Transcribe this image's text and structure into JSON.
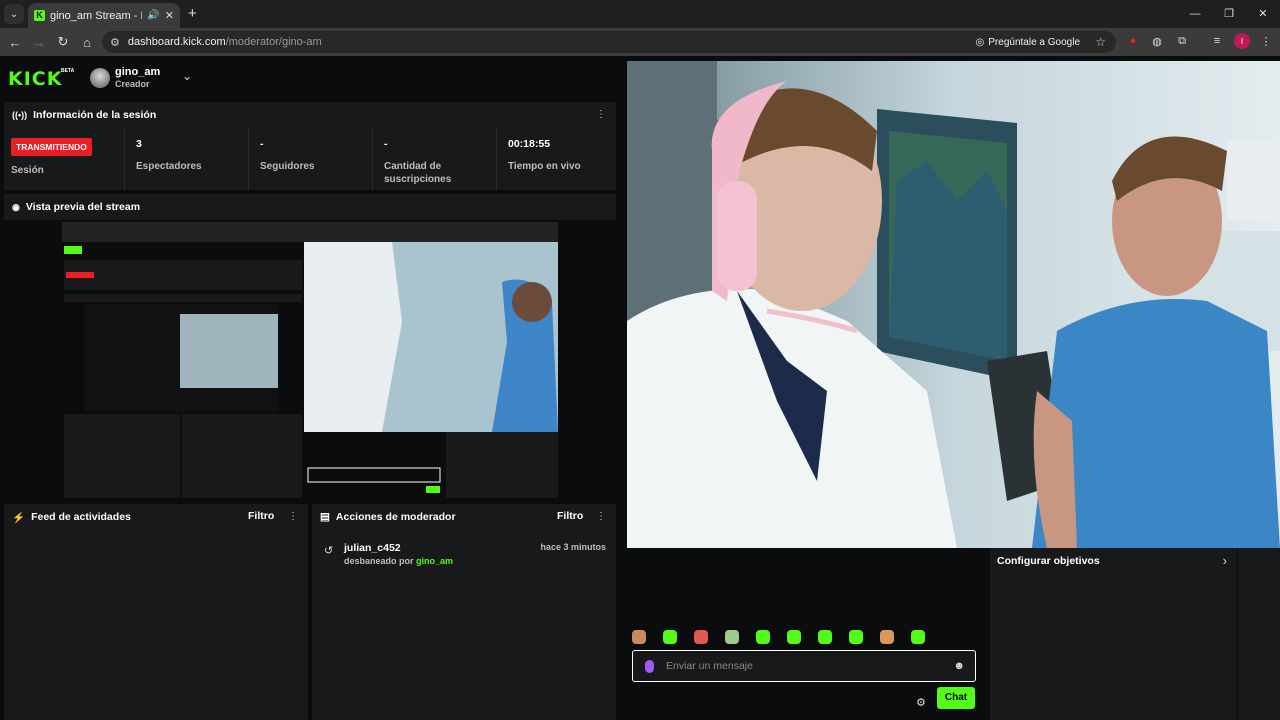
{
  "browser": {
    "tab_title": "gino_am Stream - Kick Das",
    "url_host": "dashboard.kick.com",
    "url_path": "/moderator/gino-am",
    "ask_google": "Pregúntale a Google",
    "profile_initial": "I"
  },
  "header": {
    "logo": "KICK",
    "logo_badge": "BETA",
    "channel_name": "gino_am",
    "channel_role": "Creador"
  },
  "session": {
    "title": "Información de la sesión",
    "badge": "TRANSMITIENDO",
    "session_label": "Sesión",
    "stats": [
      {
        "value": "3",
        "label": "Espectadores"
      },
      {
        "value": "-",
        "label": "Seguidores"
      },
      {
        "value": "-",
        "label": "Cantidad de suscripciones"
      },
      {
        "value": "00:18:55",
        "label": "Tiempo en vivo"
      }
    ]
  },
  "preview": {
    "title": "Vista previa del stream"
  },
  "feed": {
    "title": "Feed de actividades",
    "filter": "Filtro"
  },
  "mod_actions": {
    "title": "Acciones de moderador",
    "filter": "Filtro",
    "entries": [
      {
        "user": "julian_c452",
        "action": "desbaneado por",
        "by": "gino_am",
        "time": "hace 3 minutos"
      }
    ]
  },
  "chat": {
    "placeholder": "Enviar un mensaje",
    "send_label": "Chat",
    "emote_colors": [
      "#c98a5e",
      "#53fc18",
      "#e05a4e",
      "#9ecb8a",
      "#53fc18",
      "#53fc18",
      "#53fc18",
      "#53fc18",
      "#d89a5c",
      "#53fc18"
    ]
  },
  "goals": {
    "title": "Configurar objetivos"
  },
  "colors": {
    "brand": "#53fc18",
    "live": "#e91f26",
    "panel": "#18191b"
  }
}
